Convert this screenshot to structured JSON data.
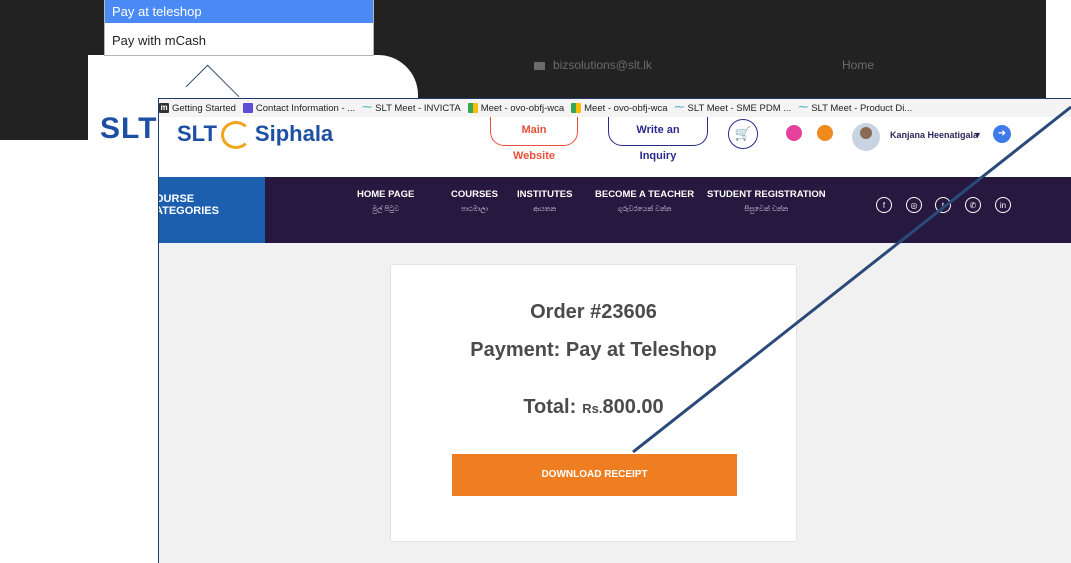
{
  "background_page": {
    "email": "bizsolutions@slt.lk",
    "home_link": "Home",
    "logo_text": "SLT"
  },
  "payment_dropdown": {
    "options": [
      "Pay at teleshop",
      "Pay with mCash"
    ],
    "selected": "Pay at teleshop"
  },
  "browser": {
    "bookmarks": [
      {
        "label": "Getting Started",
        "icon": "m-icon"
      },
      {
        "label": "Contact Information - ...",
        "icon": "list-icon"
      },
      {
        "label": "SLT Meet - INVICTA",
        "icon": "slt-icon"
      },
      {
        "label": "Meet - ovo-obfj-wca",
        "icon": "meet-icon"
      },
      {
        "label": "Meet - ovo-obfj-wca",
        "icon": "meet-icon"
      },
      {
        "label": "SLT Meet - SME PDM ...",
        "icon": "slt-icon"
      },
      {
        "label": "SLT Meet - Product Di...",
        "icon": "slt-icon"
      }
    ]
  },
  "site": {
    "logo_left": "SLT",
    "logo_right": "Siphala",
    "main_website_btn": "Main Website",
    "inquiry_btn": "Write an Inquiry",
    "user_name": "Kanjana Heenatigala",
    "course_categories": [
      "OURSE",
      "ATEGORIES"
    ],
    "nav": [
      {
        "title": "HOME PAGE",
        "sub": "මුල් පිටුව"
      },
      {
        "title": "COURSES",
        "sub": "පාඨමාලා"
      },
      {
        "title": "INSTITUTES",
        "sub": "ආයතන"
      },
      {
        "title": "BECOME A TEACHER",
        "sub": "ගුරුවරයෙක් වන්න"
      },
      {
        "title": "STUDENT REGISTRATION",
        "sub": "සිසුවෙක් වන්න"
      }
    ],
    "social_icons": [
      "facebook-icon",
      "instagram-icon",
      "twitter-icon",
      "whatsapp-icon",
      "linkedin-icon"
    ]
  },
  "order": {
    "order_number": "Order #23606",
    "payment": "Payment: Pay at Teleshop",
    "total_label": "Total:",
    "currency": "Rs.",
    "total_amount": "800.00",
    "download_button": "DOWNLOAD RECEIPT"
  },
  "colors": {
    "accent_orange": "#ef7e23",
    "nav_purple": "#26183f",
    "category_blue": "#1b5fae",
    "arrow": "#2a4a7a"
  }
}
